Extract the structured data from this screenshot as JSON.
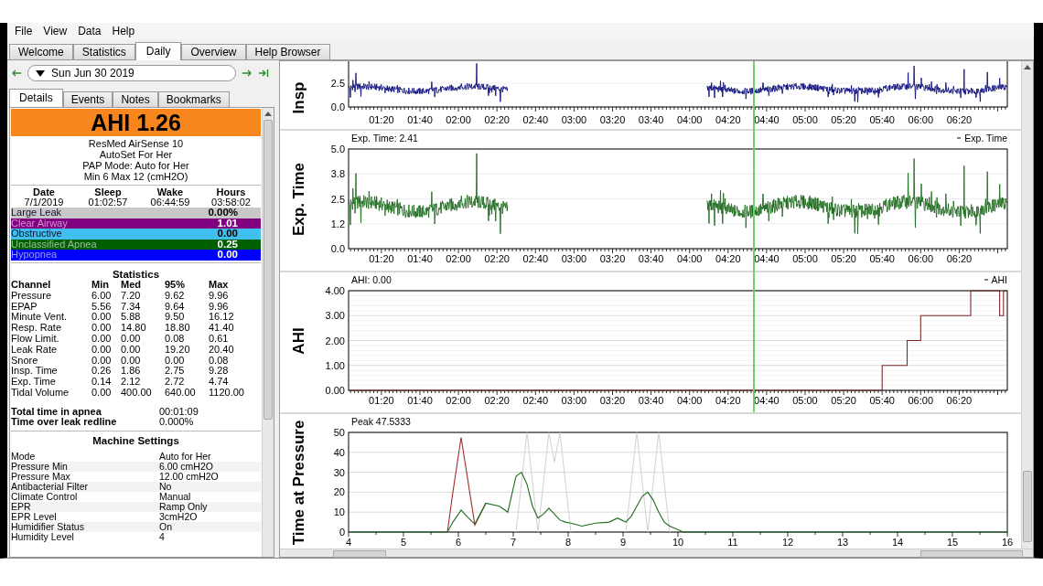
{
  "menu": [
    "File",
    "View",
    "Data",
    "Help"
  ],
  "tabs": [
    {
      "label": "Welcome",
      "selected": false
    },
    {
      "label": "Statistics",
      "selected": false
    },
    {
      "label": "Daily",
      "selected": true
    },
    {
      "label": "Overview",
      "selected": false
    },
    {
      "label": "Help Browser",
      "selected": false
    }
  ],
  "date_nav": {
    "date": "Sun Jun 30 2019"
  },
  "detail_tabs": [
    {
      "label": "Details",
      "selected": true
    },
    {
      "label": "Events",
      "selected": false
    },
    {
      "label": "Notes",
      "selected": false
    },
    {
      "label": "Bookmarks",
      "selected": false
    }
  ],
  "summary": {
    "ahi": "AHI 1.26",
    "machine_lines": [
      "ResMed AirSense 10",
      "AutoSet For Her",
      "PAP Mode: Auto for Her",
      "Min 6 Max 12 (cmH2O)"
    ],
    "session": {
      "headers": [
        "Date",
        "Sleep",
        "Wake",
        "Hours"
      ],
      "values": [
        "7/1/2019",
        "01:02:57",
        "06:44:59",
        "03:58:02"
      ]
    },
    "events": [
      {
        "name": "Large Leak",
        "value": "0.00%",
        "color": "#c8c8c8"
      },
      {
        "name": "Clear Airway",
        "value": "1.01",
        "color": "#800080"
      },
      {
        "name": "Obstructive",
        "value": "0.00",
        "color": "#40c0f0"
      },
      {
        "name": "Unclassified Apnea",
        "value": "0.25",
        "color": "#006000"
      },
      {
        "name": "Hypopnea",
        "value": "0.00",
        "color": "#0000ff"
      }
    ]
  },
  "statistics": {
    "title": "Statistics",
    "columns": [
      "Channel",
      "Min",
      "Med",
      "95%",
      "Max"
    ],
    "rows": [
      [
        "Pressure",
        "6.00",
        "7.20",
        "9.62",
        "9.96"
      ],
      [
        "EPAP",
        "5.56",
        "7.34",
        "9.64",
        "9.96"
      ],
      [
        "Minute Vent.",
        "0.00",
        "5.88",
        "9.50",
        "16.12"
      ],
      [
        "Resp. Rate",
        "0.00",
        "14.80",
        "18.80",
        "41.40"
      ],
      [
        "Flow Limit.",
        "0.00",
        "0.00",
        "0.08",
        "0.61"
      ],
      [
        "Leak Rate",
        "0.00",
        "0.00",
        "19.20",
        "20.40"
      ],
      [
        "Snore",
        "0.00",
        "0.00",
        "0.00",
        "0.08"
      ],
      [
        "Insp. Time",
        "0.26",
        "1.86",
        "2.75",
        "9.28"
      ],
      [
        "Exp. Time",
        "0.14",
        "2.12",
        "2.72",
        "4.74"
      ],
      [
        "Tidal Volume",
        "0.00",
        "400.00",
        "640.00",
        "1120.00"
      ]
    ]
  },
  "totals": [
    {
      "label": "Total time in apnea",
      "value": "00:01:09"
    },
    {
      "label": "Time over leak redline",
      "value": "0.000%"
    }
  ],
  "machine_settings": {
    "title": "Machine Settings",
    "rows": [
      [
        "Mode",
        "Auto for Her"
      ],
      [
        "Pressure Min",
        "6.00 cmH2O"
      ],
      [
        "Pressure Max",
        "12.00 cmH2O"
      ],
      [
        "Antibacterial Filter",
        "No"
      ],
      [
        "Climate Control",
        "Manual"
      ],
      [
        "EPR",
        "Ramp Only"
      ],
      [
        "EPR Level",
        "3cmH2O"
      ],
      [
        "Humidifier Status",
        "On"
      ],
      [
        "Humidity Level",
        "4"
      ]
    ]
  },
  "graphs": {
    "cursor": {
      "level": 0.614
    },
    "panels": [
      {
        "kind": "waveform",
        "ylabel": "Insp",
        "color": "#10107f",
        "yticks": [
          "2.5",
          "0.0"
        ],
        "xticks": [
          "01:20",
          "01:40",
          "02:00",
          "02:20",
          "02:40",
          "03:00",
          "03:20",
          "03:40",
          "04:00",
          "04:20",
          "04:40",
          "05:00",
          "05:20",
          "05:40",
          "06:00",
          "06:20"
        ]
      },
      {
        "kind": "waveform",
        "ylabel": "Exp. Time",
        "readout": "Exp. Time: 2.41",
        "legend": "Exp. Time",
        "color": "#1e6b1e",
        "yticks": [
          "5.0",
          "3.8",
          "2.5",
          "1.2",
          "0.0"
        ],
        "xticks": [
          "01:20",
          "01:40",
          "02:00",
          "02:20",
          "02:40",
          "03:00",
          "03:20",
          "03:40",
          "04:00",
          "04:20",
          "04:40",
          "05:00",
          "05:20",
          "05:40",
          "06:00",
          "06:20"
        ]
      },
      {
        "kind": "chart",
        "readout": "AHI: 0.00",
        "legend": "AHI",
        "chart_data": {
          "type": "line",
          "ylabel": "AHI",
          "x": [
            63,
            340,
            340,
            353,
            353,
            360,
            360,
            386,
            386,
            401,
            401,
            403,
            403,
            405
          ],
          "series": [
            {
              "color": "#7a2a2a",
              "values": [
                0,
                0,
                1,
                1,
                2,
                2,
                3,
                3,
                4,
                4,
                3,
                3,
                4,
                4
              ]
            }
          ],
          "xlim": [
            62.95,
            405
          ],
          "ylim": [
            0,
            4
          ],
          "grid": true,
          "xticks": [
            {
              "value": 80,
              "label": "01:20"
            },
            {
              "value": 100,
              "label": "01:40"
            },
            {
              "value": 120,
              "label": "02:00"
            },
            {
              "value": 140,
              "label": "02:20"
            },
            {
              "value": 160,
              "label": "02:40"
            },
            {
              "value": 180,
              "label": "03:00"
            },
            {
              "value": 200,
              "label": "03:20"
            },
            {
              "value": 220,
              "label": "03:40"
            },
            {
              "value": 240,
              "label": "04:00"
            },
            {
              "value": 260,
              "label": "04:20"
            },
            {
              "value": 280,
              "label": "04:40"
            },
            {
              "value": 300,
              "label": "05:00"
            },
            {
              "value": 320,
              "label": "05:20"
            },
            {
              "value": 340,
              "label": "05:40"
            },
            {
              "value": 360,
              "label": "06:00"
            },
            {
              "value": 380,
              "label": "06:20"
            }
          ],
          "yticks": [
            {
              "value": 0,
              "label": "0.00"
            },
            {
              "value": 1,
              "label": "1.00"
            },
            {
              "value": 2,
              "label": "2.00"
            },
            {
              "value": 3,
              "label": "3.00"
            },
            {
              "value": 4,
              "label": "4.00"
            }
          ]
        }
      },
      {
        "kind": "chart",
        "readout": "Peak 47.5333",
        "chart_data": {
          "type": "line",
          "ylabel": "Time at Pressure",
          "x": [
            4,
            5.8,
            5.9,
            6.05,
            6.15,
            6.3,
            6.5,
            6.75,
            6.9,
            7.05,
            7.15,
            7.25,
            7.35,
            7.45,
            7.55,
            7.65,
            7.75,
            7.85,
            7.95,
            8.05,
            8.25,
            8.5,
            8.75,
            8.9,
            9.05,
            9.15,
            9.25,
            9.35,
            9.45,
            9.55,
            9.65,
            9.75,
            9.85,
            10.1,
            16
          ],
          "series": [
            {
              "color": "#d4d4d4",
              "values": [
                null,
                null,
                null,
                null,
                null,
                null,
                null,
                null,
                null,
                0,
                25,
                50,
                25,
                0,
                25,
                50,
                35,
                50,
                25,
                0,
                null,
                null,
                null,
                null,
                0,
                25,
                50,
                25,
                0,
                25,
                50,
                25,
                0,
                null,
                null
              ]
            },
            {
              "color": "#a03030",
              "values": [
                null,
                0,
                20,
                47.5,
                30,
                3.5,
                14.5,
                null,
                null,
                null,
                null,
                null,
                null,
                null,
                null,
                null,
                null,
                null,
                null,
                null,
                null,
                null,
                null,
                null,
                null,
                null,
                null,
                null,
                null,
                null,
                null,
                null,
                null,
                null,
                null
              ]
            },
            {
              "color": "#1e6b1e",
              "values": [
                0,
                0,
                5,
                11,
                8,
                4,
                14.5,
                13,
                10,
                28,
                30,
                24,
                13,
                7,
                9,
                12,
                9,
                6,
                5,
                4.5,
                3,
                4.5,
                5,
                7,
                5,
                8,
                13,
                18,
                20,
                16,
                10,
                5,
                3,
                0,
                0
              ]
            }
          ],
          "xlim": [
            4,
            16
          ],
          "ylim": [
            0,
            50
          ],
          "grid": true,
          "xticks": [
            4,
            5,
            6,
            7,
            8,
            9,
            10,
            11,
            12,
            13,
            14,
            15,
            16
          ],
          "yticks": [
            0,
            10,
            20,
            30,
            40,
            50
          ]
        }
      }
    ]
  }
}
